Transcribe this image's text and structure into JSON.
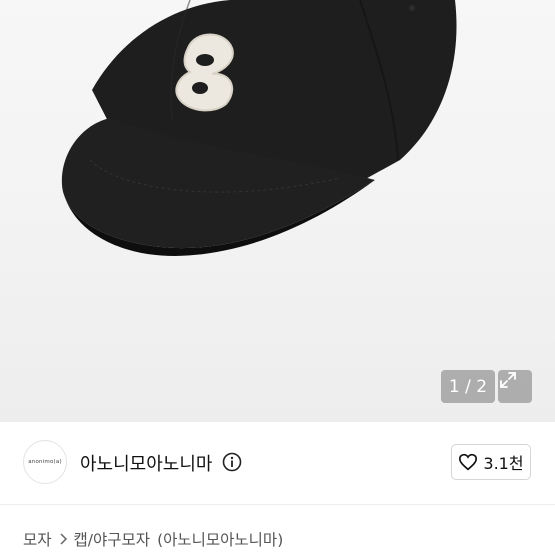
{
  "gallery": {
    "current_page": "1",
    "total_pages": "2",
    "counter_text": "1 / 2",
    "image_subject": "black baseball cap with white beaded logo patch"
  },
  "seller": {
    "avatar_text": "anonimo(a)",
    "name": "아노니모아노니마",
    "likes": "3.1천"
  },
  "breadcrumb": {
    "category": "모자",
    "subcategory": "캡/야구모자",
    "brand": "(아노니모아노니마)"
  },
  "icons": [
    "expand-icon",
    "info-icon",
    "heart-icon",
    "chevron-right-icon"
  ],
  "colors": {
    "cap": "#1f1f1f",
    "patch": "#eeeae2",
    "text": "#111111"
  }
}
